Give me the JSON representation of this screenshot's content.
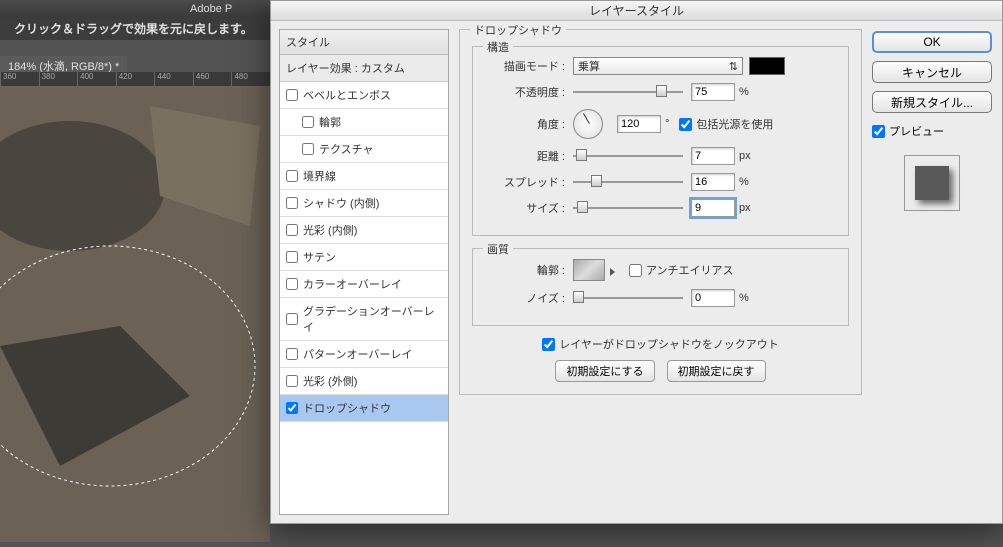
{
  "ps_header": "Adobe P",
  "hint": "クリック＆ドラッグで効果を元に戻します。",
  "doc_tab": "184% (水滴, RGB/8*) *",
  "ruler": [
    "360",
    "380",
    "400",
    "420",
    "440",
    "460",
    "480"
  ],
  "dialog": {
    "title": "レイヤースタイル",
    "styles_header": "スタイル",
    "effects_sub": "レイヤー効果 : カスタム",
    "items": [
      {
        "label": "ベベルとエンボス",
        "checked": false,
        "indent": false
      },
      {
        "label": "輪郭",
        "checked": false,
        "indent": true
      },
      {
        "label": "テクスチャ",
        "checked": false,
        "indent": true
      },
      {
        "label": "境界線",
        "checked": false,
        "indent": false
      },
      {
        "label": "シャドウ (内側)",
        "checked": false,
        "indent": false
      },
      {
        "label": "光彩 (内側)",
        "checked": false,
        "indent": false
      },
      {
        "label": "サテン",
        "checked": false,
        "indent": false
      },
      {
        "label": "カラーオーバーレイ",
        "checked": false,
        "indent": false
      },
      {
        "label": "グラデーションオーバーレイ",
        "checked": false,
        "indent": false
      },
      {
        "label": "パターンオーバーレイ",
        "checked": false,
        "indent": false
      },
      {
        "label": "光彩 (外側)",
        "checked": false,
        "indent": false
      },
      {
        "label": "ドロップシャドウ",
        "checked": true,
        "indent": false,
        "selected": true
      }
    ],
    "section_title": "ドロップシャドウ",
    "structure_title": "構造",
    "blend_label": "描画モード :",
    "blend_value": "乗算",
    "color": "#000000",
    "opacity_label": "不透明度 :",
    "opacity_value": "75",
    "angle_label": "角度 :",
    "angle_value": "120",
    "angle_deg": "°",
    "global_light": "包括光源を使用",
    "distance_label": "距離 :",
    "distance_value": "7",
    "px": "px",
    "spread_label": "スプレッド :",
    "spread_value": "16",
    "pct": "%",
    "size_label": "サイズ :",
    "size_value": "9",
    "quality_title": "画質",
    "contour_label": "輪郭 :",
    "antialias": "アンチエイリアス",
    "noise_label": "ノイズ :",
    "noise_value": "0",
    "knockout": "レイヤーがドロップシャドウをノックアウト",
    "make_default": "初期設定にする",
    "reset_default": "初期設定に戻す",
    "ok": "OK",
    "cancel": "キャンセル",
    "new_style": "新規スタイル...",
    "preview": "プレビュー"
  }
}
